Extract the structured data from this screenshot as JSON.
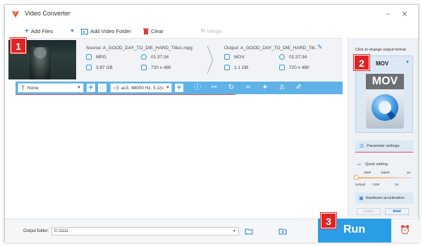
{
  "window": {
    "title": "Video Converter"
  },
  "toolbar": {
    "add_files": "Add Files",
    "add_video_folder": "Add Video Folder",
    "clear": "Clear",
    "merge": "Merge"
  },
  "task": {
    "source_label": "Source: A_GOOD_DAY_TO_DIE_HARD_Title1.mpg",
    "output_label": "Output: A_GOOD_DAY_TO_DIE_HARD_Titl...",
    "source": {
      "format": "MPG",
      "duration": "01:37:34",
      "size": "3.97 GB",
      "resolution": "720 x 480"
    },
    "output": {
      "format": "MOV",
      "duration": "01:37:34",
      "size": "1.1 GB",
      "resolution": "720 x 480"
    }
  },
  "controls": {
    "subtitle_value": "None",
    "audio_value": "ac3, 48000 Hz, 5.1(s"
  },
  "side": {
    "change_format_label": "Click to change output format",
    "format_value": "MOV",
    "format_icon_text": "MOV",
    "param_settings": "Parameter settings",
    "quick_setting": "Quick setting",
    "quality_top": [
      "480P",
      "1080P",
      "4K"
    ],
    "quality_bottom": [
      "Default",
      "720P",
      "2K"
    ],
    "hw_accel": "Hardware acceleration",
    "nvidia": "NVIDIA",
    "intel": "Intel"
  },
  "bottom": {
    "output_folder_label": "Output folder:",
    "output_folder_value": "C:\\1111",
    "run_label": "Run"
  },
  "badges": {
    "one": "1",
    "two": "2",
    "three": "3"
  },
  "colors": {
    "accent": "#2a9de6",
    "badge": "#e02424",
    "bar": "#5fb2e8"
  }
}
